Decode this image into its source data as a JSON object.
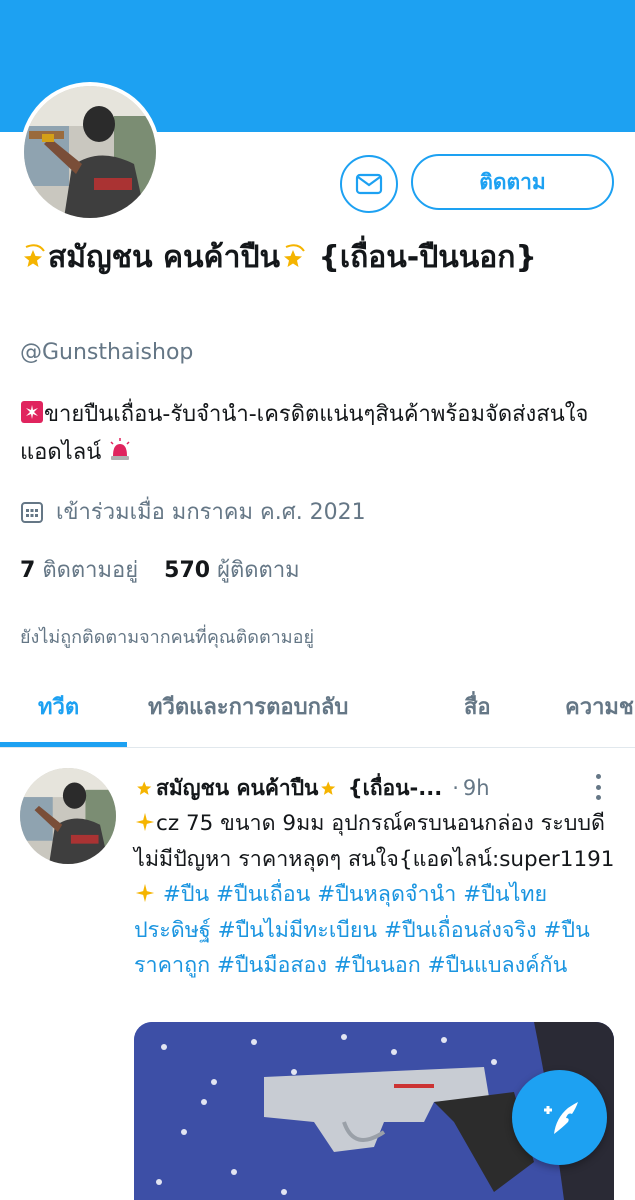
{
  "profile": {
    "display_name": "สมัญชน คนค้าปืน",
    "display_name_suffix": "{เถื่อน-ปืนนอก}",
    "handle": "@Gunsthaishop",
    "bio_text": "ขายปืนเถื่อน-รับจำนำ-เครดิตแน่นๆสินค้าพร้อมจัดส่งสนใจแอดไลน์",
    "joined": "เข้าร่วมเมื่อ มกราคม ค.ศ. 2021",
    "following_count": "7",
    "following_label": "ติดตามอยู่",
    "followers_count": "570",
    "followers_label": "ผู้ติดตาม",
    "not_followed_note": "ยังไม่ถูกติดตามจากคนที่คุณติดตามอยู่",
    "follow_button": "ติดตาม",
    "message_icon": "envelope-icon",
    "calendar_icon": "calendar-icon"
  },
  "tabs": [
    {
      "label": "ทวีต",
      "active": true
    },
    {
      "label": "ทวีตและการตอบกลับ",
      "active": false
    },
    {
      "label": "สื่อ",
      "active": false
    },
    {
      "label": "ความช",
      "active": false
    }
  ],
  "tweet": {
    "author_name": "สมัญชน คนค้าปืน",
    "author_suffix": "{เถื่อน-...",
    "separator": "·",
    "time": "9h",
    "text_part1": "cz 75 ขนาด 9มม อุปกรณ์ครบนอนกล่อง ระบบดี ไม่มีปัญหา ราคาหลุดๆ สนใจ{แอดไลน์:super1191",
    "hashtags": [
      "#ปืน",
      "#ปืนเถื่อน",
      "#ปืนหลุดจำนำ",
      "#ปืนไทยประดิษฐ์",
      "#ปืนไม่มีทะเบียน",
      "#ปืนเถื่อนส่งจริง",
      "#ปืนราคาถูก",
      "#ปืนมือสอง",
      "#ปืนนอก",
      "#ปืนแบลงค์กัน"
    ]
  },
  "fab": {
    "icon": "compose-tweet-icon"
  },
  "colors": {
    "accent": "#1da1f2",
    "secondary_text": "#657786",
    "hashtag": "#1b95e0"
  }
}
